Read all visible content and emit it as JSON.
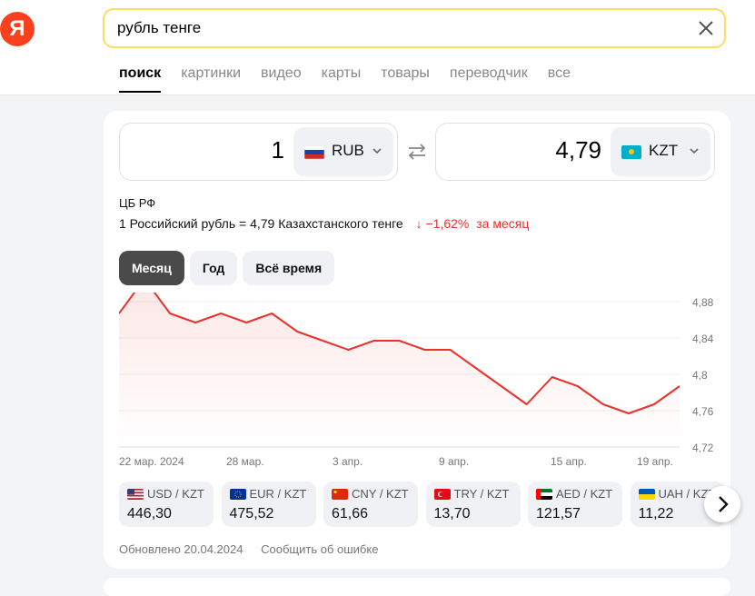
{
  "search": {
    "query": "рубль тенге"
  },
  "tabs": [
    "поиск",
    "картинки",
    "видео",
    "карты",
    "товары",
    "переводчик",
    "все"
  ],
  "logo": "Я",
  "converter": {
    "from": {
      "amount": "1",
      "currency": "RUB"
    },
    "to": {
      "amount": "4,79",
      "currency": "KZT"
    }
  },
  "source": "ЦБ РФ",
  "rate_text": "1 Российский рубль = 4,79 Казахстанского тенге",
  "change": {
    "value": "−1,62%",
    "period": "за месяц",
    "arrow": "↓"
  },
  "periods": [
    "Месяц",
    "Год",
    "Всё время"
  ],
  "chart_data": {
    "type": "line",
    "x_ticks": [
      "22 мар. 2024",
      "28 мар.",
      "3 апр.",
      "9 апр.",
      "15 апр.",
      "19 апр."
    ],
    "y_ticks": [
      "4,88",
      "4,84",
      "4,8",
      "4,76",
      "4,72"
    ],
    "ylim": [
      4.72,
      4.89
    ],
    "values": [
      4.867,
      4.905,
      4.867,
      4.857,
      4.867,
      4.857,
      4.867,
      4.847,
      4.837,
      4.827,
      4.837,
      4.837,
      4.827,
      4.827,
      4.807,
      4.787,
      4.767,
      4.797,
      4.787,
      4.767,
      4.757,
      4.767,
      4.787
    ],
    "color": "#e8322a"
  },
  "pairs": [
    {
      "label": "USD / KZT",
      "value": "446,30"
    },
    {
      "label": "EUR / KZT",
      "value": "475,52"
    },
    {
      "label": "CNY / KZT",
      "value": "61,66"
    },
    {
      "label": "TRY / KZT",
      "value": "13,70"
    },
    {
      "label": "AED / KZT",
      "value": "121,57"
    },
    {
      "label": "UAH / KZT",
      "value": "11,22"
    }
  ],
  "footer": {
    "updated": "Обновлено 20.04.2024",
    "report": "Сообщить об ошибке"
  }
}
